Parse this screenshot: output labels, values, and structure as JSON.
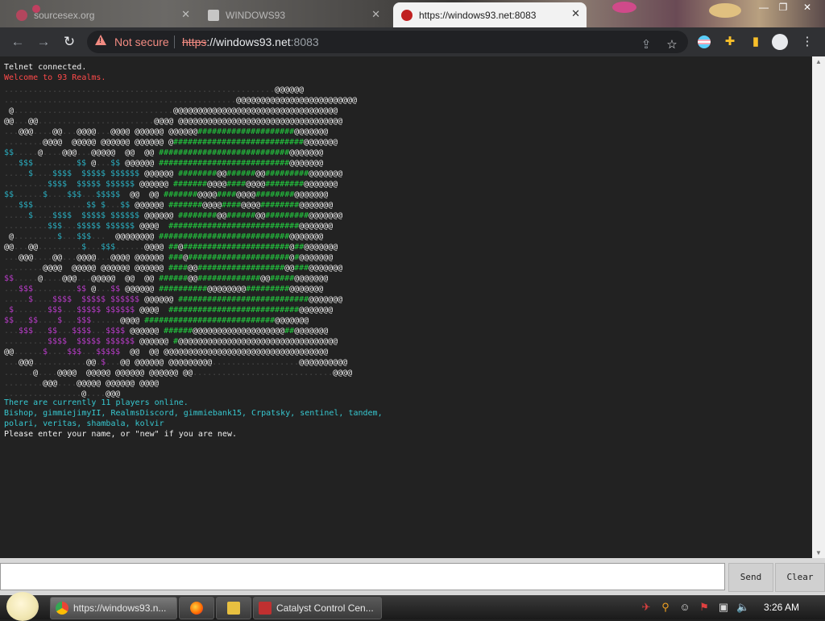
{
  "browser": {
    "tabs": [
      {
        "label": "sourcesex.org"
      },
      {
        "label": "WINDOWS93"
      },
      {
        "label": "https://windows93.net:8083",
        "active": true
      }
    ],
    "security_label": "Not secure",
    "url_scheme": "https",
    "url_host": "://windows93.net",
    "url_port": ":8083"
  },
  "terminal": {
    "line1": "Telnet connected.",
    "line2": "Welcome to 93 Realms.",
    "online": "There are currently 11 players online.",
    "players_line1": "Bishop, gimmiejimyII, RealmsDiscord, gimmiebank15, Crpatsky, sentinel, tandem,",
    "players_line2": "polari, veritas, shambala, kolvir",
    "prompt": "Please enter your name, or \"new\" if you are new."
  },
  "input": {
    "value": "",
    "send_label": "Send",
    "clear_label": "Clear"
  },
  "taskbar": {
    "tasks": [
      {
        "label": "https://windows93.n..."
      },
      {
        "label": ""
      },
      {
        "label": ""
      },
      {
        "label": "Catalyst Control Cen..."
      }
    ],
    "clock": "3:26 AM"
  },
  "colors": {
    "terminal_bg": "#222222",
    "art_white": "#f0f0f0",
    "art_green": "#23d040",
    "art_cyan": "#2aaec0",
    "art_magenta": "#b83cc8",
    "welcome_red": "#ff4a4a",
    "info_cyan": "#37c8d0"
  }
}
